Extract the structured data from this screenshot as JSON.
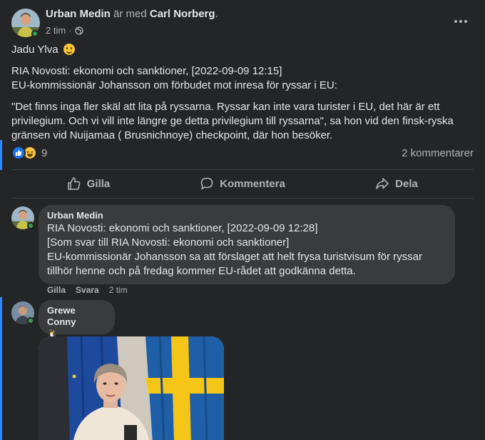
{
  "post": {
    "author": "Urban Medin",
    "with_text": "är med",
    "tagged": "Carl Norberg",
    "tagged_suffix": ".",
    "time": "2 tim",
    "separator": "·",
    "privacy_icon": "globe-icon",
    "text_line1": "Jadu Ylva",
    "text_line2": "RIA Novosti: ekonomi och sanktioner, [2022-09-09 12:15]",
    "text_line3": "EU-kommissionär Johansson om förbudet mot inresa för ryssar i EU:",
    "text_quote": "\"Det finns inga fler skäl att lita på ryssarna. Ryssar kan inte vara turister i EU, det här är ett privilegium. Och vi vill inte längre ge detta privilegium till ryssarna\", sa hon vid den finsk-ryska gränsen vid Nuijamaa ( Brusnichnoye) checkpoint, där hon besöker."
  },
  "reactions": {
    "count": "9",
    "comments": "2 kommentarer",
    "icons": [
      "like-icon",
      "haha-icon"
    ]
  },
  "actions": {
    "like": "Gilla",
    "comment": "Kommentera",
    "share": "Dela"
  },
  "comments": [
    {
      "author": "Urban Medin",
      "text": "RIA Novosti: ekonomi och sanktioner, [2022-09-09 12:28]\n[Som svar till RIA Novosti: ekonomi och sanktioner]\nEU-kommissionär Johansson sa att förslaget att helt frysa turistvisum för ryssar tillhör henne och på fredag kommer EU-rådet att godkänna detta.",
      "like": "Gilla",
      "reply": "Svara",
      "time": "2 tim"
    },
    {
      "author": "Grewe Conny",
      "text": "🐧"
    }
  ],
  "colors": {
    "background": "#242526",
    "bubble": "#3a3b3c",
    "accent": "#2d88ff",
    "online": "#31a24c"
  }
}
